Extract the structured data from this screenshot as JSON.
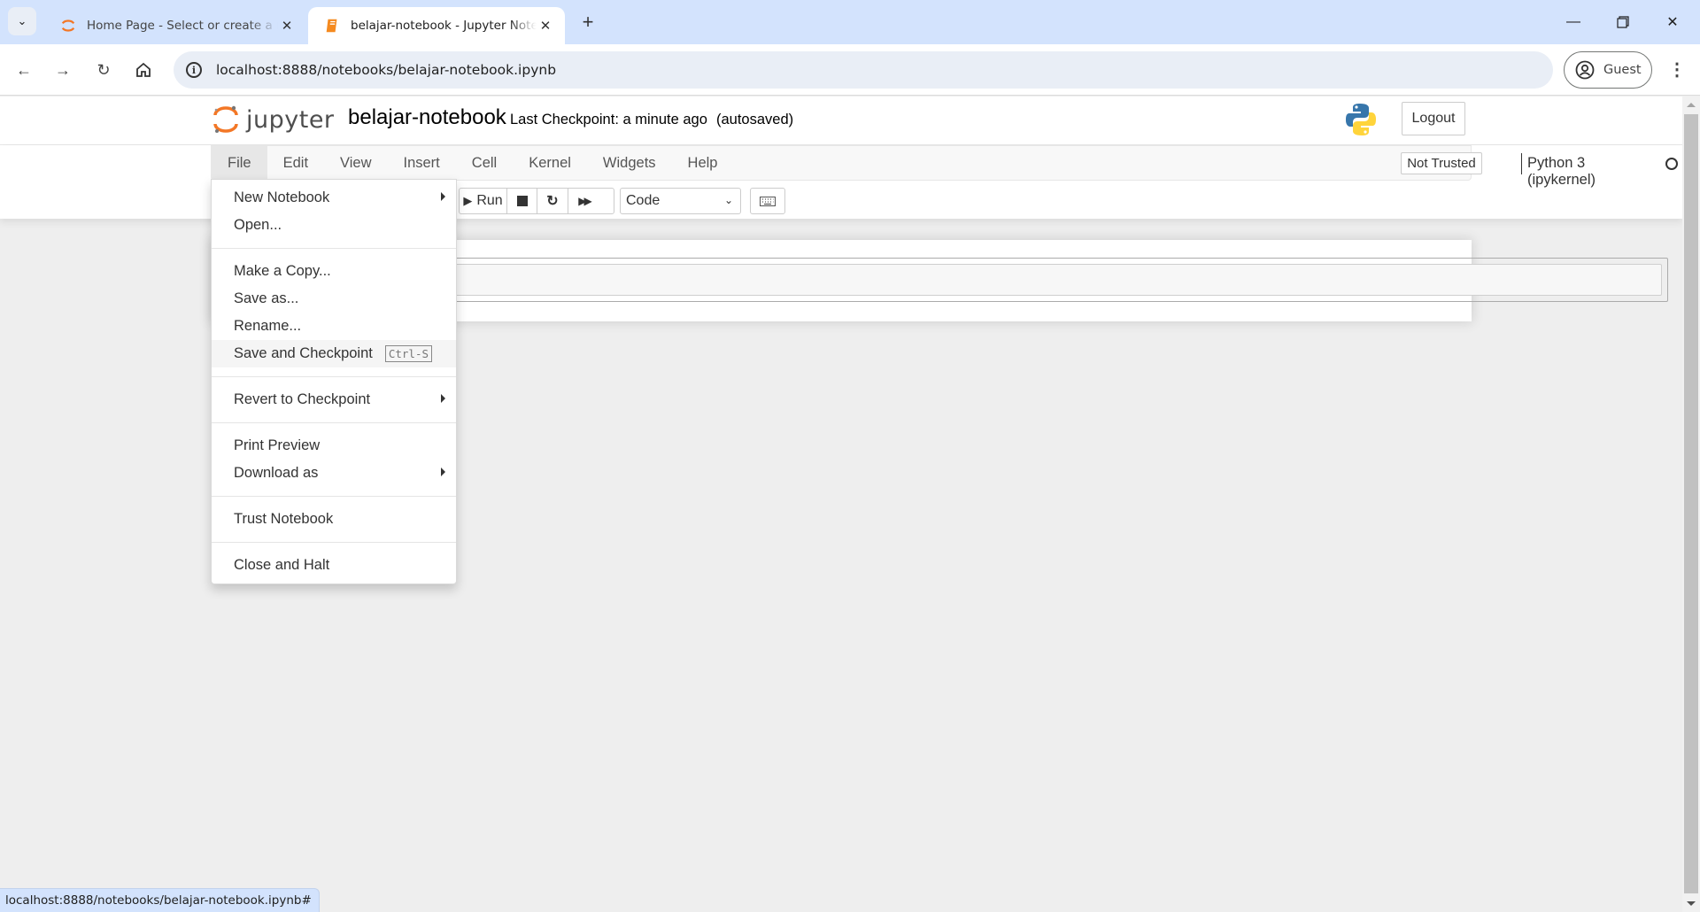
{
  "browser": {
    "tabs": [
      {
        "title": "Home Page - Select or create a notebook",
        "active": false,
        "icon": "jupyter-spinner-icon"
      },
      {
        "title": "belajar-notebook - Jupyter Notebook",
        "active": true,
        "icon": "notebook-book-icon"
      }
    ],
    "address": "localhost:8888/notebooks/belajar-notebook.ipynb",
    "profile_label": "Guest",
    "status_url": "localhost:8888/notebooks/belajar-notebook.ipynb#"
  },
  "jupyter": {
    "wordmark": "jupyter",
    "notebook_name": "belajar-notebook",
    "checkpoint": "Last Checkpoint: a minute ago",
    "autosave": "(autosaved)",
    "logout_label": "Logout",
    "menu": [
      "File",
      "Edit",
      "View",
      "Insert",
      "Cell",
      "Kernel",
      "Widgets",
      "Help"
    ],
    "open_menu": "File",
    "trust_status": "Not Trusted",
    "kernel_name": "Python 3 (ipykernel)",
    "kernel_state": "idle",
    "toolbar": {
      "run_label": "Run",
      "cell_type": "Code"
    },
    "file_menu": [
      {
        "label": "New Notebook",
        "submenu": true
      },
      {
        "label": "Open..."
      },
      {
        "divider": true
      },
      {
        "label": "Make a Copy..."
      },
      {
        "label": "Save as..."
      },
      {
        "label": "Rename..."
      },
      {
        "label": "Save and Checkpoint",
        "shortcut": "Ctrl-S",
        "highlighted": true
      },
      {
        "divider": true
      },
      {
        "label": "Revert to Checkpoint",
        "submenu": true
      },
      {
        "divider": true
      },
      {
        "label": "Print Preview"
      },
      {
        "label": "Download as",
        "submenu": true
      },
      {
        "divider": true
      },
      {
        "label": "Trust Notebook"
      },
      {
        "divider": true
      },
      {
        "label": "Close and Halt"
      }
    ]
  },
  "colors": {
    "jupyter_orange": "#f37726",
    "chrome_tabstrip": "#d3e3fd",
    "python_blue": "#3776ab",
    "python_yellow": "#ffd43b"
  }
}
